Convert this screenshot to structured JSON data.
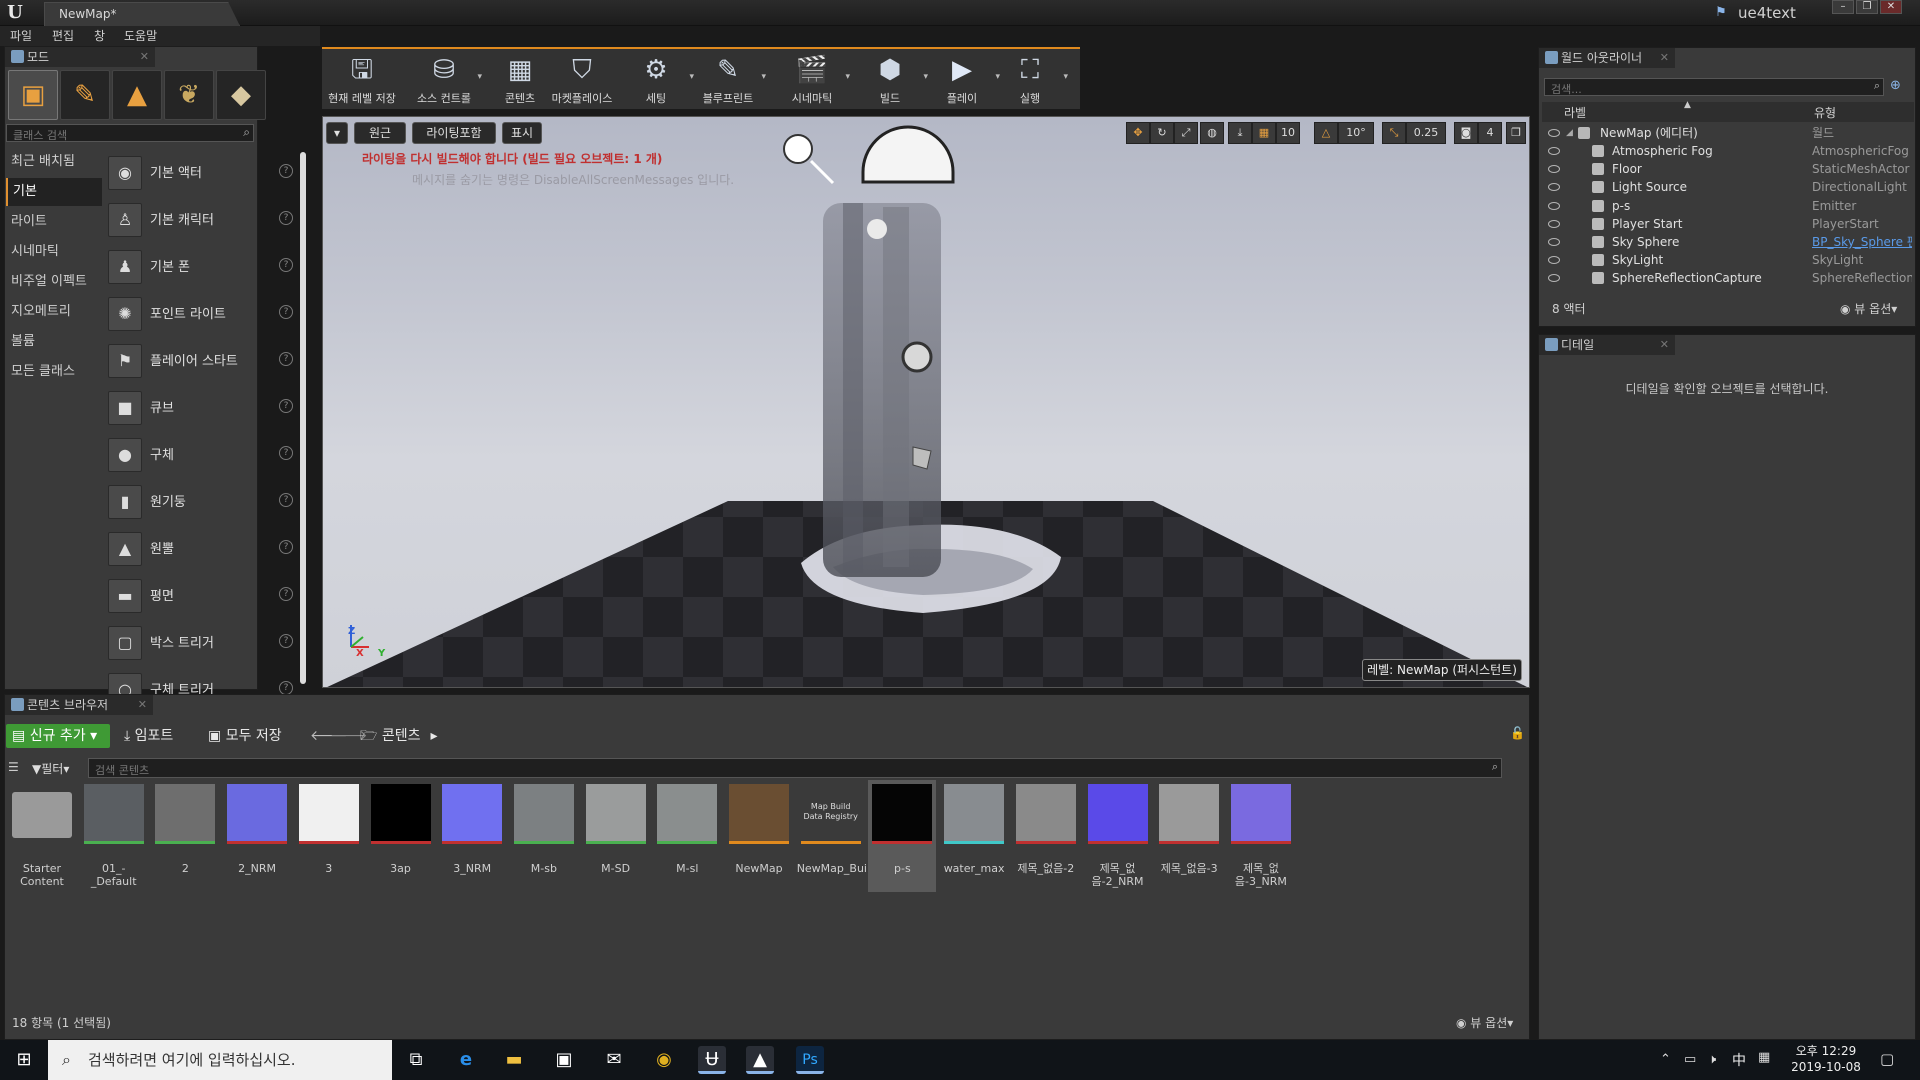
{
  "window": {
    "doc_tab": "NewMap*",
    "project_name": "ue4text",
    "logo_letter": "U"
  },
  "menu": [
    "파일",
    "편집",
    "창",
    "도움말"
  ],
  "modes": {
    "tab_title": "모드",
    "search_placeholder": "클래스 검색",
    "categories": [
      "최근 배치됨",
      "기본",
      "라이트",
      "시네마틱",
      "비주얼 이펙트",
      "지오메트리",
      "볼륨",
      "모든 클래스"
    ],
    "active_category": "기본",
    "items": [
      "기본 액터",
      "기본 캐릭터",
      "기본 폰",
      "포인트 라이트",
      "플레이어 스타트",
      "큐브",
      "구체",
      "원기둥",
      "원뿔",
      "평면",
      "박스 트리거",
      "구체 트리거"
    ]
  },
  "toolbar": {
    "buttons": [
      "현재 레벨 저장",
      "소스 컨트롤",
      "콘텐츠",
      "마켓플레이스",
      "세팅",
      "블루프린트",
      "시네마틱",
      "빌드",
      "플레이",
      "실행"
    ]
  },
  "viewport": {
    "perspective_label": "원근",
    "lighting_label": "라이팅포함",
    "show_label": "표시",
    "warning": "라이팅을 다시 빌드해야 합니다 (빌드 필요 오브젝트: 1 개)",
    "hint": "메시지를 숨기는 명령은 DisableAllScreenMessages 입니다.",
    "grid_snap": "10",
    "rot_snap": "10°",
    "scale_snap": "0.25",
    "camera_speed": "4",
    "level_badge": "레벨:  NewMap (퍼시스턴트)",
    "axis_z": "Z",
    "axis_x": "X",
    "axis_y": "Y"
  },
  "outliner": {
    "tab_title": "월드 아웃라이너",
    "search_placeholder": "검색...",
    "col_label": "라벨",
    "col_type": "유형",
    "root": {
      "name": "NewMap (에디터)",
      "type": "월드"
    },
    "rows": [
      {
        "name": "Atmospheric Fog",
        "type": "AtmosphericFog"
      },
      {
        "name": "Floor",
        "type": "StaticMeshActor"
      },
      {
        "name": "Light Source",
        "type": "DirectionalLight"
      },
      {
        "name": "p-s",
        "type": "Emitter"
      },
      {
        "name": "Player Start",
        "type": "PlayerStart"
      },
      {
        "name": "Sky Sphere",
        "type": "BP_Sky_Sphere 편"
      },
      {
        "name": "SkyLight",
        "type": "SkyLight"
      },
      {
        "name": "SphereReflectionCapture",
        "type": "SphereReflectionC"
      }
    ],
    "actor_count": "8 액터",
    "view_options": "뷰 옵션"
  },
  "details": {
    "tab_title": "디테일",
    "empty_message": "디테일을 확인할 오브젝트를 선택합니다."
  },
  "content_browser": {
    "tab_title": "콘텐츠 브라우저",
    "add_new": "신규 추가",
    "import": "임포트",
    "save_all": "모두 저장",
    "path_root": "콘텐츠",
    "filter": "필터",
    "search_placeholder": "검색 콘텐츠",
    "assets": [
      {
        "name": "Starter Content",
        "color": "#9a9a9a"
      },
      {
        "name": "01_-_Default",
        "color": "#5a5e62"
      },
      {
        "name": "2",
        "color": "#6e6e6e"
      },
      {
        "name": "2_NRM",
        "color": "#6a6ae0"
      },
      {
        "name": "3",
        "color": "#f0f0f0"
      },
      {
        "name": "3ap",
        "color": "#000000"
      },
      {
        "name": "3_NRM",
        "color": "#7070f0"
      },
      {
        "name": "M-sb",
        "color": "#7c8082"
      },
      {
        "name": "M-SD",
        "color": "#9a9c9c"
      },
      {
        "name": "M-sl",
        "color": "#8a8e8e"
      },
      {
        "name": "NewMap",
        "color": "#6a4e32"
      },
      {
        "name": "NewMap_BuiltData",
        "color": "#3a3a3a"
      },
      {
        "name": "p-s",
        "color": "#050505"
      },
      {
        "name": "water_max",
        "color": "#888c90"
      },
      {
        "name": "제목_없음-2",
        "color": "#8a8a8a"
      },
      {
        "name": "제목_없음-2_NRM",
        "color": "#5a4ae8"
      },
      {
        "name": "제목_없음-3",
        "color": "#9a9a9a"
      },
      {
        "name": "제목_없음-3_NRM",
        "color": "#7a6ae0"
      }
    ],
    "built_data_thumb_text": "Map Build Data Registry",
    "status": "18 항목 (1 선택됨)",
    "view_options": "뷰 옵션"
  },
  "taskbar": {
    "search_text": "검색하려면 여기에 입력하십시오.",
    "time": "오후 12:29",
    "date": "2019-10-08",
    "ime": "中"
  }
}
